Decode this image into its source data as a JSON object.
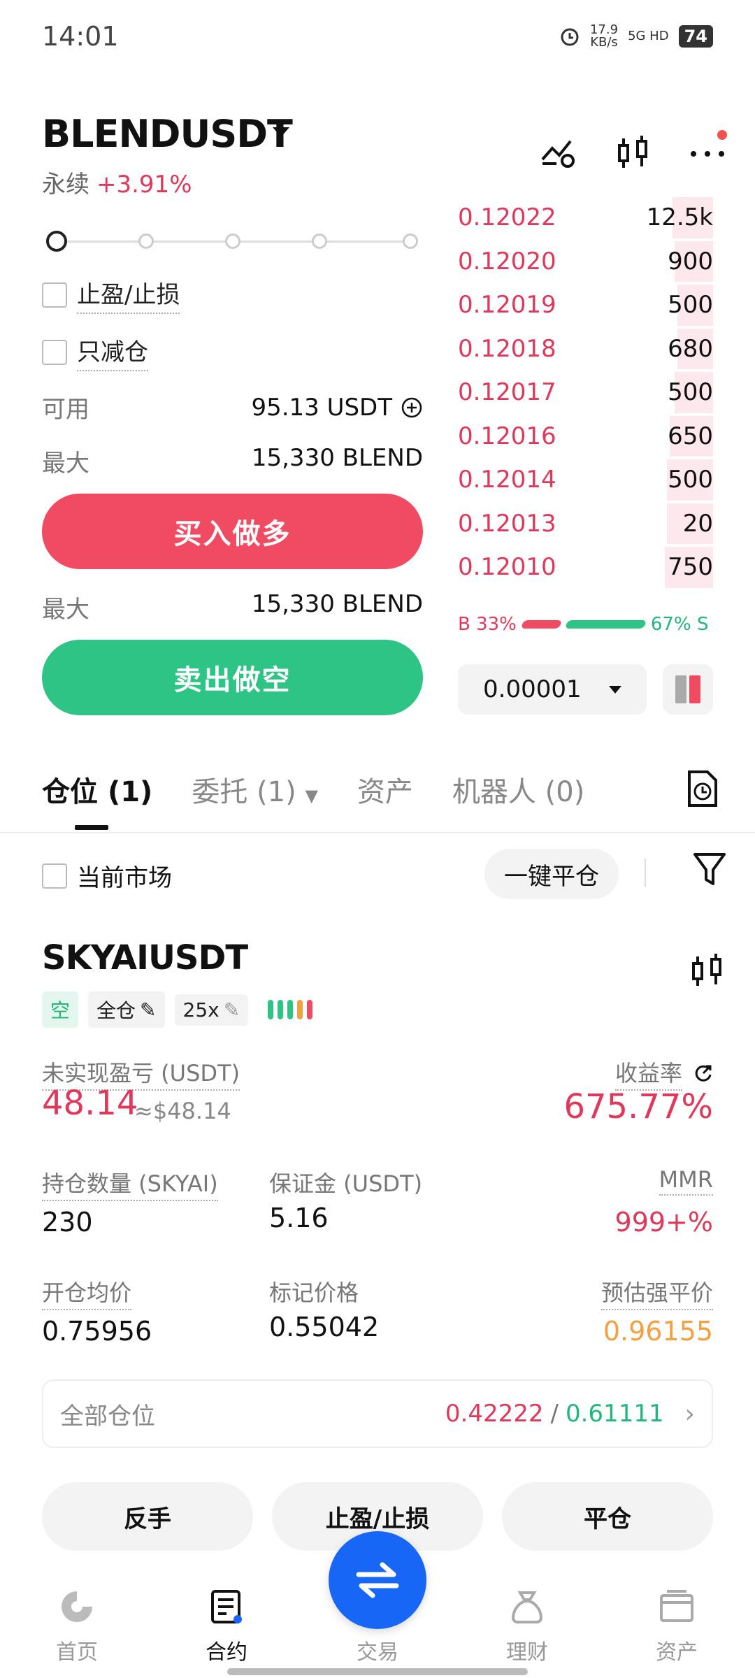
{
  "status_bar": {
    "time": "14:01",
    "net_speed": "17.9",
    "net_unit": "KB/s",
    "signal": "5G HD",
    "battery": "74"
  },
  "header": {
    "pair": "BLENDUSDT",
    "type": "永续",
    "change": "+3.91%"
  },
  "order_form": {
    "tpsl_label": "止盈/止损",
    "reduce_only_label": "只减仓",
    "available_label": "可用",
    "available_value": "95.13 USDT",
    "max_label": "最大",
    "max_buy": "15,330 BLEND",
    "buy_button": "买入做多",
    "max_sell": "15,330 BLEND",
    "sell_button": "卖出做空"
  },
  "orderbook": {
    "asks": [
      {
        "price": "0.12022",
        "qty": "12.5k",
        "depth": 0.16
      },
      {
        "price": "0.12020",
        "qty": "900",
        "depth": 0.15
      },
      {
        "price": "0.12019",
        "qty": "500",
        "depth": 0.14
      },
      {
        "price": "0.12018",
        "qty": "680",
        "depth": 0.14
      },
      {
        "price": "0.12017",
        "qty": "500",
        "depth": 0.15
      },
      {
        "price": "0.12016",
        "qty": "650",
        "depth": 0.17
      },
      {
        "price": "0.12014",
        "qty": "500",
        "depth": 0.18
      },
      {
        "price": "0.12013",
        "qty": "20",
        "depth": 0.18
      },
      {
        "price": "0.12010",
        "qty": "750",
        "depth": 0.19
      }
    ],
    "buy_ratio_label": "B 33%",
    "sell_ratio_label": "67% S",
    "buy_ratio": 0.33,
    "sell_ratio": 0.67,
    "precision": "0.00001"
  },
  "tabs": {
    "positions": "仓位",
    "positions_count": "(1)",
    "orders": "委托",
    "orders_count": "(1)",
    "assets": "资产",
    "bots": "机器人",
    "bots_count": "(0)"
  },
  "filters": {
    "current_market": "当前市场",
    "close_all": "一键平仓"
  },
  "position": {
    "symbol": "SKYAIUSDT",
    "side": "空",
    "margin_mode": "全仓",
    "leverage": "25x",
    "pnl_label": "未实现盈亏 (USDT)",
    "pnl_value": "48.14",
    "pnl_usd": "≈$48.14",
    "roi_label": "收益率",
    "roi_value": "675.77%",
    "size_label": "持仓数量 (SKYAI)",
    "size_value": "230",
    "margin_label": "保证金 (USDT)",
    "margin_value": "5.16",
    "mmr_label": "MMR",
    "mmr_value": "999+%",
    "entry_label": "开仓均价",
    "entry_value": "0.75956",
    "mark_label": "标记价格",
    "mark_value": "0.55042",
    "liq_label": "预估强平价",
    "liq_value": "0.96155",
    "all_positions_label": "全部仓位",
    "tp_value": "0.42222",
    "sl_value": "0.61111",
    "slash": "/",
    "reverse_button": "反手",
    "tpsl_button": "止盈/止损",
    "close_button": "平仓"
  },
  "bottom_nav": {
    "home": "首页",
    "futures": "合约",
    "trade": "交易",
    "earn": "理财",
    "assets": "资产"
  },
  "colors": {
    "red": "#f04b62",
    "green": "#2ec486",
    "blue": "#1766f5",
    "orange": "#f5a040"
  }
}
